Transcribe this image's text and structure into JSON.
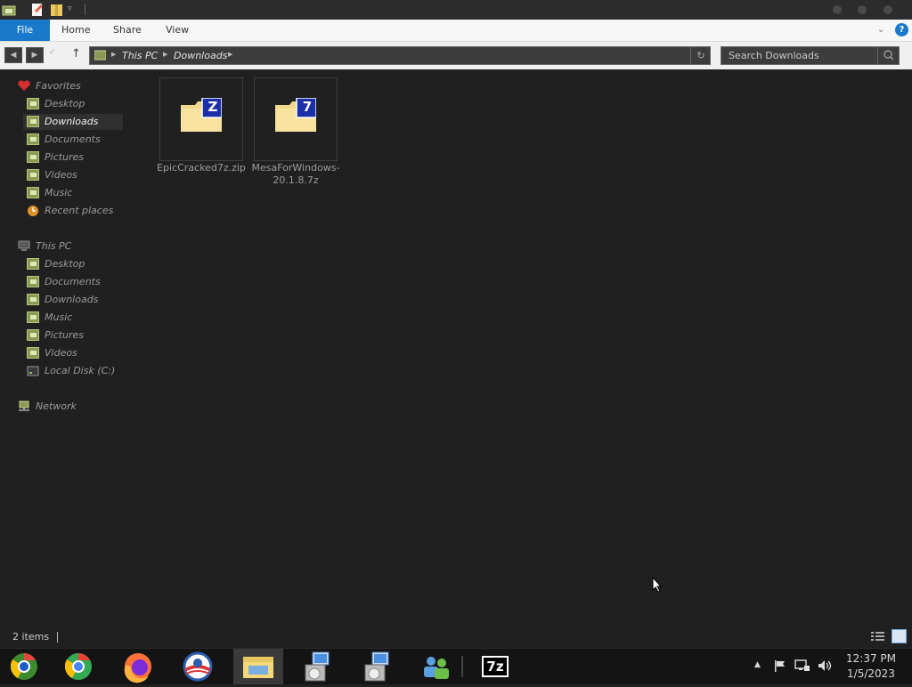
{
  "ribbon": {
    "tabs": [
      "File",
      "Home",
      "Share",
      "View"
    ]
  },
  "address": {
    "crumbs": [
      "This PC",
      "Downloads"
    ]
  },
  "search": {
    "placeholder": "Search Downloads"
  },
  "sidebar": {
    "favorites": {
      "header": "Favorites",
      "items": [
        "Desktop",
        "Downloads",
        "Documents",
        "Pictures",
        "Videos",
        "Music",
        "Recent places"
      ]
    },
    "this_pc": {
      "header": "This PC",
      "items": [
        "Desktop",
        "Documents",
        "Downloads",
        "Music",
        "Pictures",
        "Videos",
        "Local Disk (C:)"
      ]
    },
    "network": {
      "header": "Network"
    }
  },
  "files": [
    {
      "name": "EpicCracked7z.zip",
      "badge": "Z"
    },
    {
      "name": "MesaForWindows-20.1.8.7z",
      "badge": "7"
    }
  ],
  "status": {
    "items": "2 items"
  },
  "taskbar": {
    "apps": [
      "chrome-beta-icon",
      "chrome-icon",
      "firefox-icon",
      "obama-logo-icon",
      "file-explorer-icon",
      "installer-icon",
      "installer-icon",
      "users-icon",
      "7zip-icon"
    ],
    "sevenzip_label": "7z",
    "clock_time": "12:37 PM",
    "clock_date": "1/5/2023"
  },
  "colors": {
    "file_tab": "#1979ca",
    "background": "#202020",
    "taskbar": "#141414"
  }
}
